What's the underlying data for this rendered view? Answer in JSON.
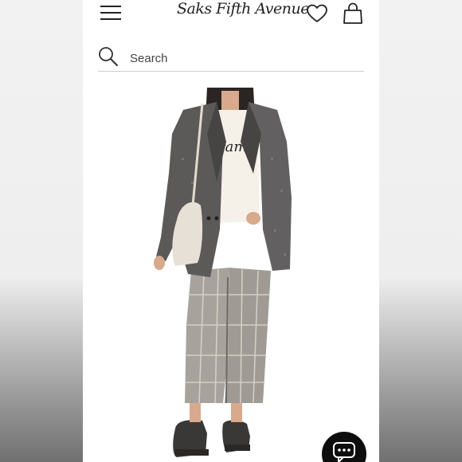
{
  "header": {
    "logo_text": "Saks Fifth Avenue",
    "icons": {
      "menu": "hamburger-menu-icon",
      "wishlist": "heart-icon",
      "cart": "shopping-bag-icon"
    }
  },
  "search": {
    "placeholder": "Search",
    "icon": "search-icon"
  },
  "product": {
    "image_description_icon": "product-photo",
    "shirt_text": "ram"
  },
  "chat": {
    "icon": "chat-bubble-icon"
  },
  "colors": {
    "text": "#222222",
    "background": "#ffffff",
    "divider": "#cfcfcf",
    "chat_button": "#0d0d0d"
  }
}
